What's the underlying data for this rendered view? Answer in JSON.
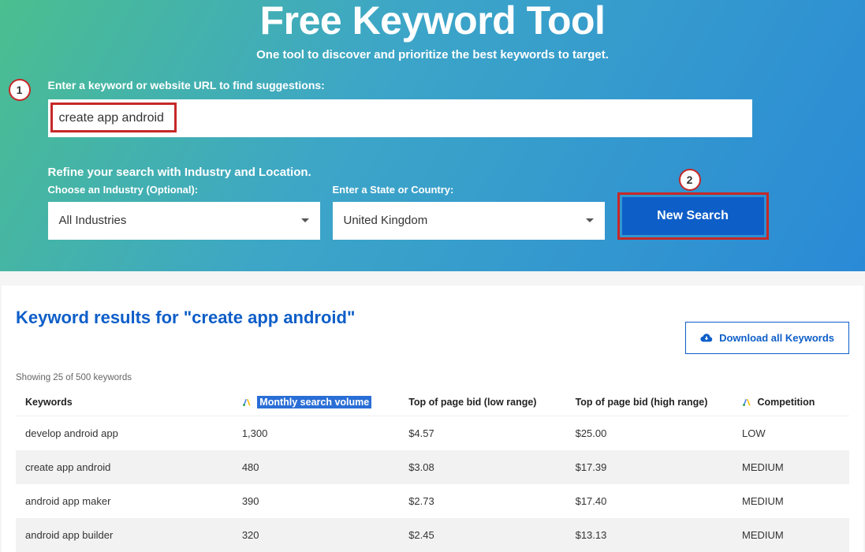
{
  "hero": {
    "title": "Free Keyword Tool",
    "subtitle": "One tool to discover and prioritize the best keywords to target."
  },
  "form": {
    "input_label": "Enter a keyword or website URL to find suggestions:",
    "input_value": "create app android",
    "refine_label": "Refine your search with Industry and Location.",
    "industry_label": "Choose an Industry (Optional):",
    "industry_value": "All Industries",
    "location_label": "Enter a State or Country:",
    "location_value": "United Kingdom",
    "search_button": "New Search"
  },
  "annotations": {
    "marker1": "1",
    "marker2": "2"
  },
  "results": {
    "title_prefix": "Keyword results for \"",
    "title_query": "create app android",
    "title_suffix": "\"",
    "download_label": "Download all Keywords",
    "showing_text": "Showing 25 of 500 keywords",
    "headers": {
      "keywords": "Keywords",
      "volume": "Monthly search volume",
      "low": "Top of page bid (low range)",
      "high": "Top of page bid (high range)",
      "comp": "Competition"
    },
    "rows": [
      {
        "kw": "develop android app",
        "vol": "1,300",
        "low": "$4.57",
        "high": "$25.00",
        "comp": "LOW"
      },
      {
        "kw": "create app android",
        "vol": "480",
        "low": "$3.08",
        "high": "$17.39",
        "comp": "MEDIUM"
      },
      {
        "kw": "android app maker",
        "vol": "390",
        "low": "$2.73",
        "high": "$17.40",
        "comp": "MEDIUM"
      },
      {
        "kw": "android app builder",
        "vol": "320",
        "low": "$2.45",
        "high": "$13.13",
        "comp": "MEDIUM"
      }
    ]
  }
}
